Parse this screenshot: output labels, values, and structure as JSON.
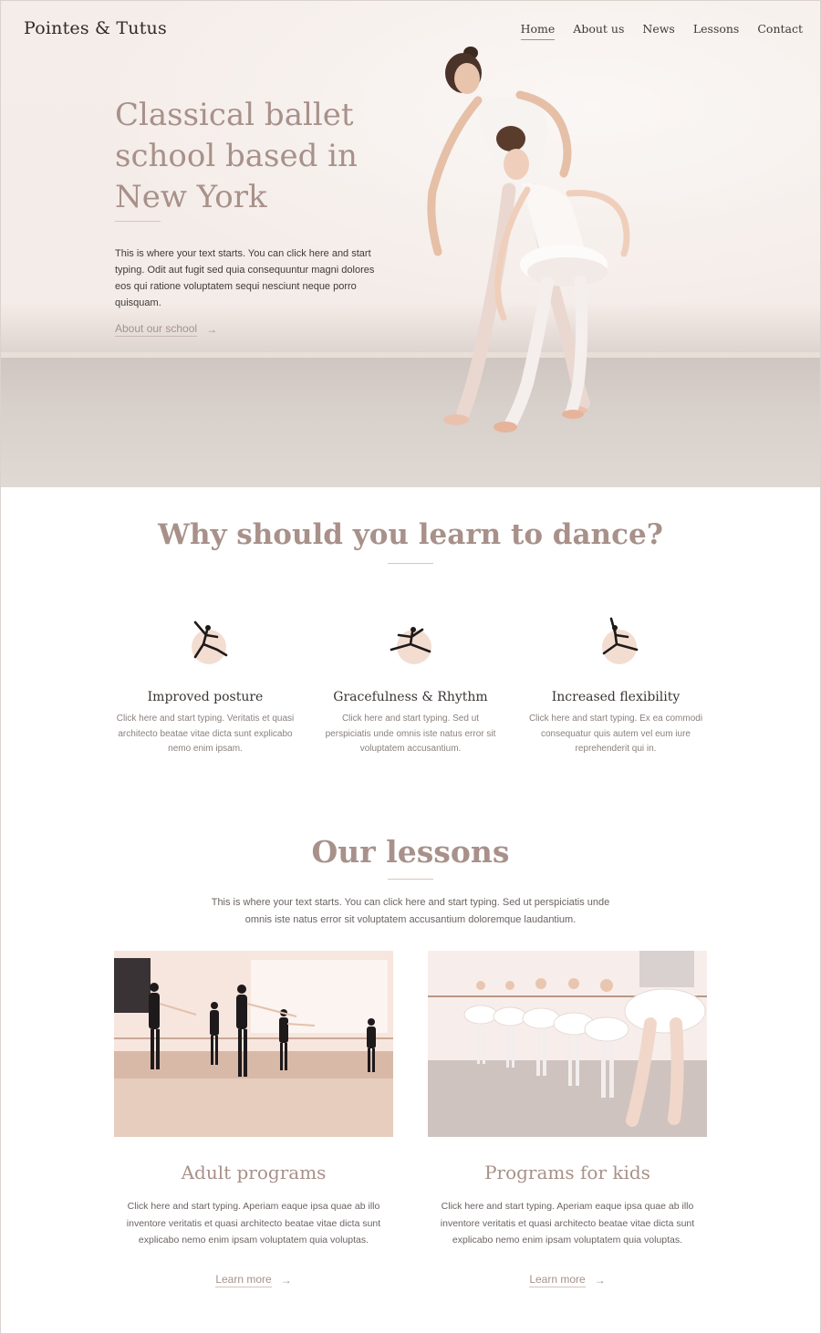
{
  "header": {
    "logo": "Pointes & Tutus",
    "nav": [
      {
        "label": "Home",
        "active": true
      },
      {
        "label": "About us",
        "active": false
      },
      {
        "label": "News",
        "active": false
      },
      {
        "label": "Lessons",
        "active": false
      },
      {
        "label": "Contact",
        "active": false
      }
    ]
  },
  "hero": {
    "title": "Classical ballet school based in New York",
    "text": "This is where your text starts. You can click here and start typing. Odit aut fugit sed quia consequuntur magni dolores eos qui ratione voluptatem sequi nesciunt neque porro quisquam.",
    "link": "About our school",
    "link_icon": "arrow-right-icon"
  },
  "why": {
    "title": "Why should you learn to dance?",
    "features": [
      {
        "title": "Improved posture",
        "text": "Click here and start typing. Veritatis et quasi architecto beatae vitae dicta sunt explicabo nemo enim ipsam.",
        "icon": "ballerina-leap-icon"
      },
      {
        "title": "Gracefulness & Rhythm",
        "text": "Click here and start typing. Sed ut perspiciatis unde omnis iste natus error sit voluptatem accusantium.",
        "icon": "ballerina-split-icon"
      },
      {
        "title": "Increased flexibility",
        "text": "Click here and start typing. Ex ea commodi consequatur quis autem vel eum iure reprehenderit qui in.",
        "icon": "ballerina-arabesque-icon"
      }
    ]
  },
  "lessons": {
    "title": "Our lessons",
    "intro": "This is where your text starts. You can click here and start typing. Sed ut perspiciatis unde omnis iste natus error sit voluptatem accusantium doloremque laudantium.",
    "cards": [
      {
        "title": "Adult programs",
        "text": "Click here and start typing. Aperiam eaque ipsa quae ab illo inventore veritatis et quasi architecto beatae vitae dicta sunt explicabo nemo enim ipsam voluptatem quia voluptas.",
        "link": "Learn more"
      },
      {
        "title": "Programs for kids",
        "text": "Click here and start typing. Aperiam eaque ipsa quae ab illo inventore veritatis et quasi architecto beatae vitae dicta sunt explicabo nemo enim ipsam voluptatem quia voluptas.",
        "link": "Learn more"
      }
    ]
  },
  "colors": {
    "accent": "#a8918a",
    "hero_bg": "#f5ede9",
    "icon_blob": "#f3ddd1",
    "heading_dark": "#3a3532"
  }
}
